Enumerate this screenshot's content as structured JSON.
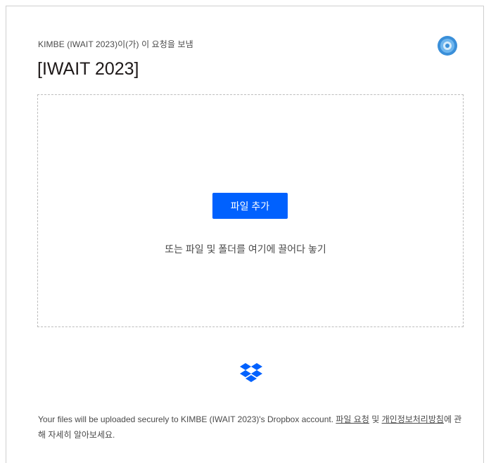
{
  "request": {
    "sender_line": "KIMBE (IWAIT 2023)이(가) 이 요청을 보냄",
    "title": "[IWAIT 2023]"
  },
  "dropzone": {
    "add_button_label": "파일 추가",
    "hint": "또는 파일 및 폴더를 여기에 끌어다 놓기"
  },
  "footer": {
    "text_prefix": "Your files will be uploaded securely to KIMBE (IWAIT 2023)'s Dropbox account. ",
    "link_file_requests": "파일 요청",
    "text_and": " 및 ",
    "link_privacy": "개인정보처리방침",
    "text_suffix": "에 관해 자세히 알아보세요."
  },
  "icons": {
    "avatar": "avatar-icon",
    "logo": "dropbox-logo-icon"
  },
  "colors": {
    "accent": "#0061fe",
    "avatar": "#3a8fd9",
    "text": "#4a4a4a"
  }
}
